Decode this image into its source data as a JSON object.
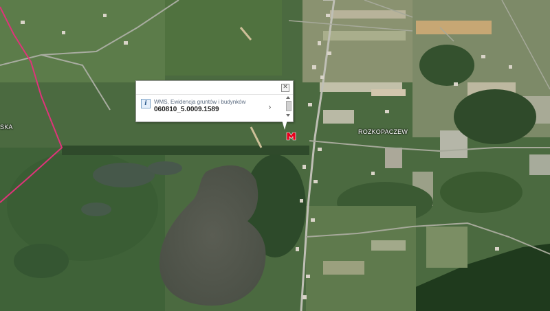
{
  "map": {
    "labels": {
      "village": "ROZKOPACZEW",
      "partial_left": "SKA"
    },
    "boundary_color": "#e0337a",
    "marker_color": "#e8001e"
  },
  "popup": {
    "layer_title": "WMS, Ewidencja gruntów i budynków",
    "parcel_id": "060810_5.0009.1589",
    "close_symbol": "✕",
    "info_symbol": "i",
    "chevron_symbol": "›"
  },
  "icons": [
    "info-icon",
    "close-icon",
    "chevron-right-icon",
    "map-marker-icon"
  ]
}
